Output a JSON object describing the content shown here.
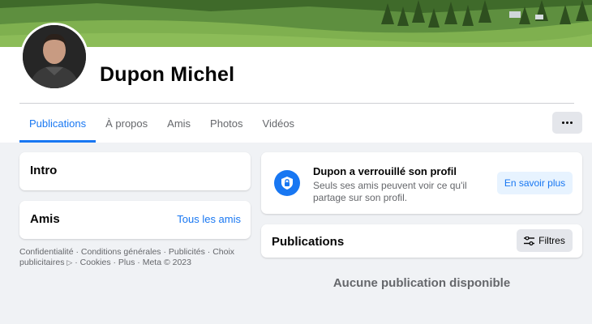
{
  "profile": {
    "name": "Dupon Michel"
  },
  "tabs": [
    {
      "label": "Publications",
      "active": true
    },
    {
      "label": "À propos"
    },
    {
      "label": "Amis"
    },
    {
      "label": "Photos"
    },
    {
      "label": "Vidéos"
    }
  ],
  "more_icon": "more-horizontal-icon",
  "intro": {
    "title": "Intro"
  },
  "friends": {
    "title": "Amis",
    "link": "Tous les amis"
  },
  "footer": {
    "confidentialite": "Confidentialité",
    "conditions": "Conditions générales",
    "publicites": "Publicités",
    "choix": "Choix publicitaires",
    "cookies": "Cookies",
    "plus": "Plus",
    "meta": "Meta © 2023"
  },
  "locked": {
    "title": "Dupon a verrouillé son profil",
    "description": "Seuls ses amis peuvent voir ce qu'il partage sur son profil.",
    "button": "En savoir plus",
    "icon": "shield-lock-icon"
  },
  "posts": {
    "title": "Publications",
    "filter_label": "Filtres",
    "filter_icon": "sliders-icon",
    "empty": "Aucune publication disponible"
  },
  "colors": {
    "accent": "#1877f2",
    "background": "#f0f2f5",
    "secondary_text": "#65676b"
  }
}
